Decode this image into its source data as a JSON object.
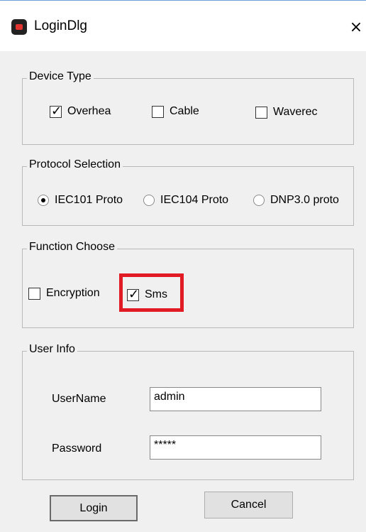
{
  "window": {
    "title": "LoginDlg",
    "close_glyph": "×",
    "icon": "app-icon"
  },
  "device_type": {
    "title": "Device Type",
    "options": [
      {
        "label": "Overhea",
        "checked": true
      },
      {
        "label": "Cable",
        "checked": false
      },
      {
        "label": "Waverec",
        "checked": false
      }
    ]
  },
  "protocol": {
    "title": "Protocol Selection",
    "options": [
      {
        "label": "IEC101 Proto",
        "selected": true
      },
      {
        "label": "IEC104 Proto",
        "selected": false
      },
      {
        "label": "DNP3.0 proto",
        "selected": false
      }
    ]
  },
  "function": {
    "title": "Function Choose",
    "options": [
      {
        "label": "Encryption",
        "checked": false
      },
      {
        "label": "Sms",
        "checked": true
      }
    ],
    "highlight_color": "#e01b24"
  },
  "user_info": {
    "title": "User Info",
    "username_label": "UserName",
    "username_value": "admin",
    "password_label": "Password",
    "password_value": "*****"
  },
  "buttons": {
    "login": "Login",
    "cancel": "Cancel"
  }
}
